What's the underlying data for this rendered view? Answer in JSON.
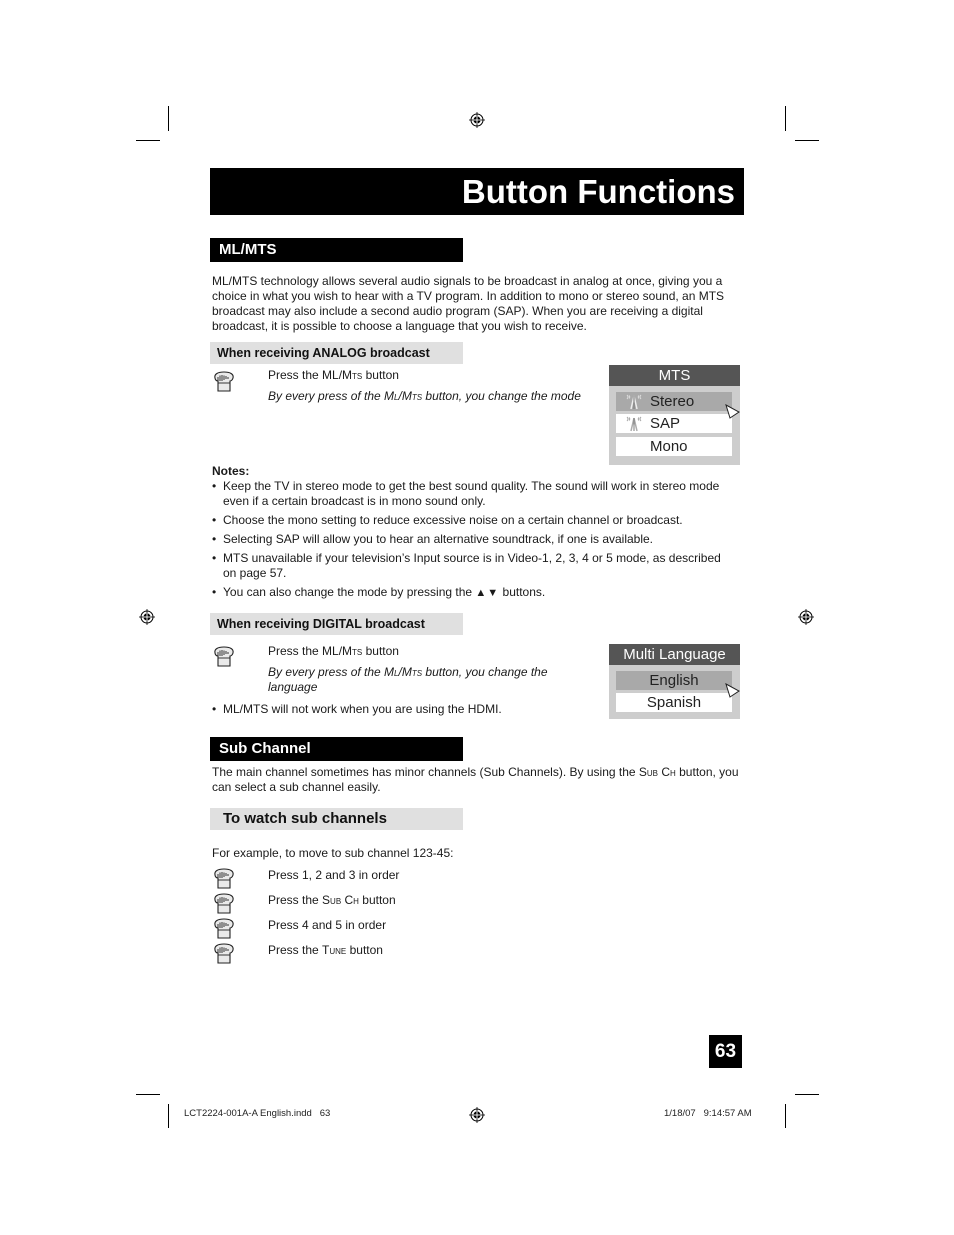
{
  "page": {
    "title": "Button Functions",
    "page_number": "63"
  },
  "mlmts": {
    "heading": "ML/MTS",
    "intro": "ML/MTS technology allows several audio signals to be broadcast in analog at once, giving you a choice in what you wish to hear with a TV program. In addition to mono or stereo sound, an MTS broadcast may also include a second audio program (SAP).  When you are receiving a digital broadcast, it is possible to choose a language that you wish to receive.",
    "analog": {
      "heading": "When receiving ANALOG broadcast",
      "step_pre": "Press the ML/M",
      "step_sc": "ts",
      "step_post": " button",
      "desc_pre": "By every press of the M",
      "desc_sc": "l",
      "desc_mid": "/M",
      "desc_sc2": "ts",
      "desc_post": " button, you change the mode",
      "hand_icon": "pointing-hand-icon"
    },
    "mts_menu": {
      "title": "MTS",
      "items": [
        {
          "label": "Stereo",
          "selected": true,
          "icon": "antenna-icon"
        },
        {
          "label": "SAP",
          "selected": false,
          "icon": "antenna-icon"
        },
        {
          "label": "Mono",
          "selected": false,
          "icon": ""
        }
      ],
      "cursor_icon": "cursor-arrow-icon"
    },
    "notes": {
      "title": "Notes:",
      "items": [
        "Keep the TV in stereo mode to get the best sound quality. The sound will work in stereo mode even if a certain broadcast is in mono sound only.",
        "Choose the mono setting to reduce excessive noise on a certain channel or broadcast.",
        "Selecting SAP will allow you to hear an alternative soundtrack, if one is available.",
        "MTS unavailable if your television’s Input source is in Video-1, 2, 3, 4 or 5 mode, as described on page 57."
      ],
      "last_pre": "You can also change the mode by pressing the ",
      "last_arrows": "▲▼",
      "last_post": "  buttons."
    },
    "digital": {
      "heading": "When receiving DIGITAL broadcast",
      "step_pre": "Press the ML/M",
      "step_sc": "ts",
      "step_post": " button",
      "desc_pre": "By every press of the M",
      "desc_sc": "l",
      "desc_mid": "/M",
      "desc_sc2": "ts",
      "desc_post": " button, you change the language",
      "note": "ML/MTS will not work when you are using the HDMI."
    },
    "lang_menu": {
      "title": "Multi Language",
      "items": [
        {
          "label": "English",
          "selected": true
        },
        {
          "label": "Spanish",
          "selected": false
        }
      ]
    }
  },
  "subchannel": {
    "heading": "Sub Channel",
    "intro_pre": "The main channel sometimes has minor channels (Sub Channels).  By using the ",
    "intro_sc": "Sub Ch",
    "intro_post": " button, you can select a sub channel easily.",
    "watch": {
      "heading": "To watch sub channels",
      "example": "For example, to move to sub channel 123-45:",
      "steps": [
        {
          "pre": "Press 1, 2 and 3 in order",
          "sc": "",
          "post": ""
        },
        {
          "pre": "Press the ",
          "sc": "Sub Ch",
          "post": " button"
        },
        {
          "pre": "Press 4 and 5 in order",
          "sc": "",
          "post": ""
        },
        {
          "pre": "Press the ",
          "sc": "Tune",
          "post": " button"
        }
      ]
    }
  },
  "slug": {
    "file": "LCT2224-001A-A English.indd   63",
    "datetime": "1/18/07   9:14:57 AM"
  }
}
